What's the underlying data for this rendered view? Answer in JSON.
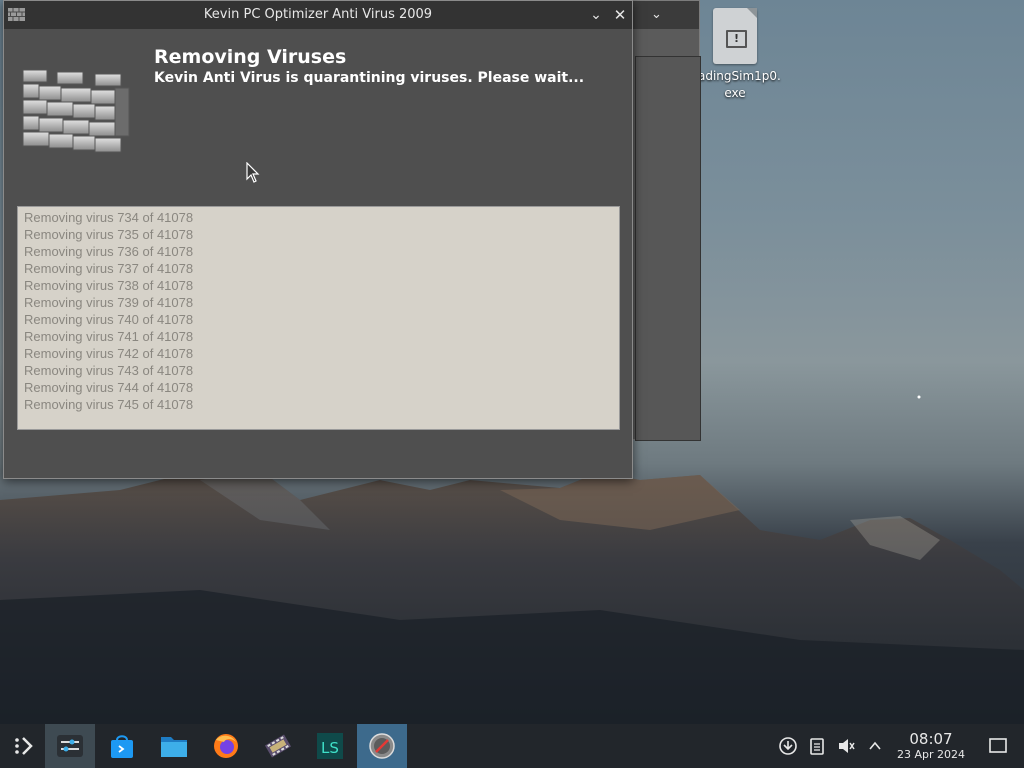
{
  "window": {
    "title": "Kevin PC Optimizer Anti Virus 2009",
    "heading": "Removing Viruses",
    "subheading": "Kevin Anti Virus is quarantining viruses. Please wait...",
    "log_lines": [
      "Removing virus 734 of 41078",
      "Removing virus 735 of 41078",
      "Removing virus 736 of 41078",
      "Removing virus 737 of 41078",
      "Removing virus 738 of 41078",
      "Removing virus 739 of 41078",
      "Removing virus 740 of 41078",
      "Removing virus 741 of 41078",
      "Removing virus 742 of 41078",
      "Removing virus 743 of 41078",
      "Removing virus 744 of 41078",
      "Removing virus 745 of 41078"
    ]
  },
  "desktop": {
    "icon_label_line1": "adingSim1p0.",
    "icon_label_line2": "exe"
  },
  "taskbar": {
    "items": [
      "app-launcher-icon",
      "system-settings-icon",
      "discover-store-icon",
      "file-manager-icon",
      "firefox-icon",
      "video-editor-icon",
      "ls-app-icon",
      "antivirus-app-icon"
    ],
    "time": "08:07",
    "date": "23 Apr 2024"
  },
  "colors": {
    "taskbar_bg": "#22262b",
    "window_bg": "#4f4f4f",
    "titlebar_bg": "#333333",
    "log_bg": "#d6d2c9",
    "log_text": "#8a8780",
    "focused_task": "#3d6a8c"
  }
}
